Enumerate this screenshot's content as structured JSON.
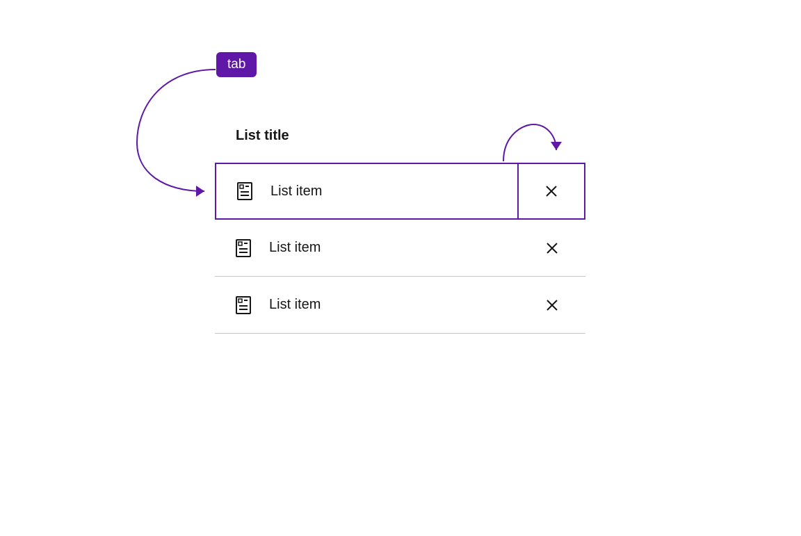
{
  "badge": {
    "label": "tab"
  },
  "list": {
    "title": "List title",
    "items": [
      {
        "label": "List item",
        "focused": true
      },
      {
        "label": "List item",
        "focused": false
      },
      {
        "label": "List item",
        "focused": false
      }
    ]
  },
  "colors": {
    "accent": "#5e17a6",
    "border": "#c6c6c6",
    "text": "#161616"
  }
}
